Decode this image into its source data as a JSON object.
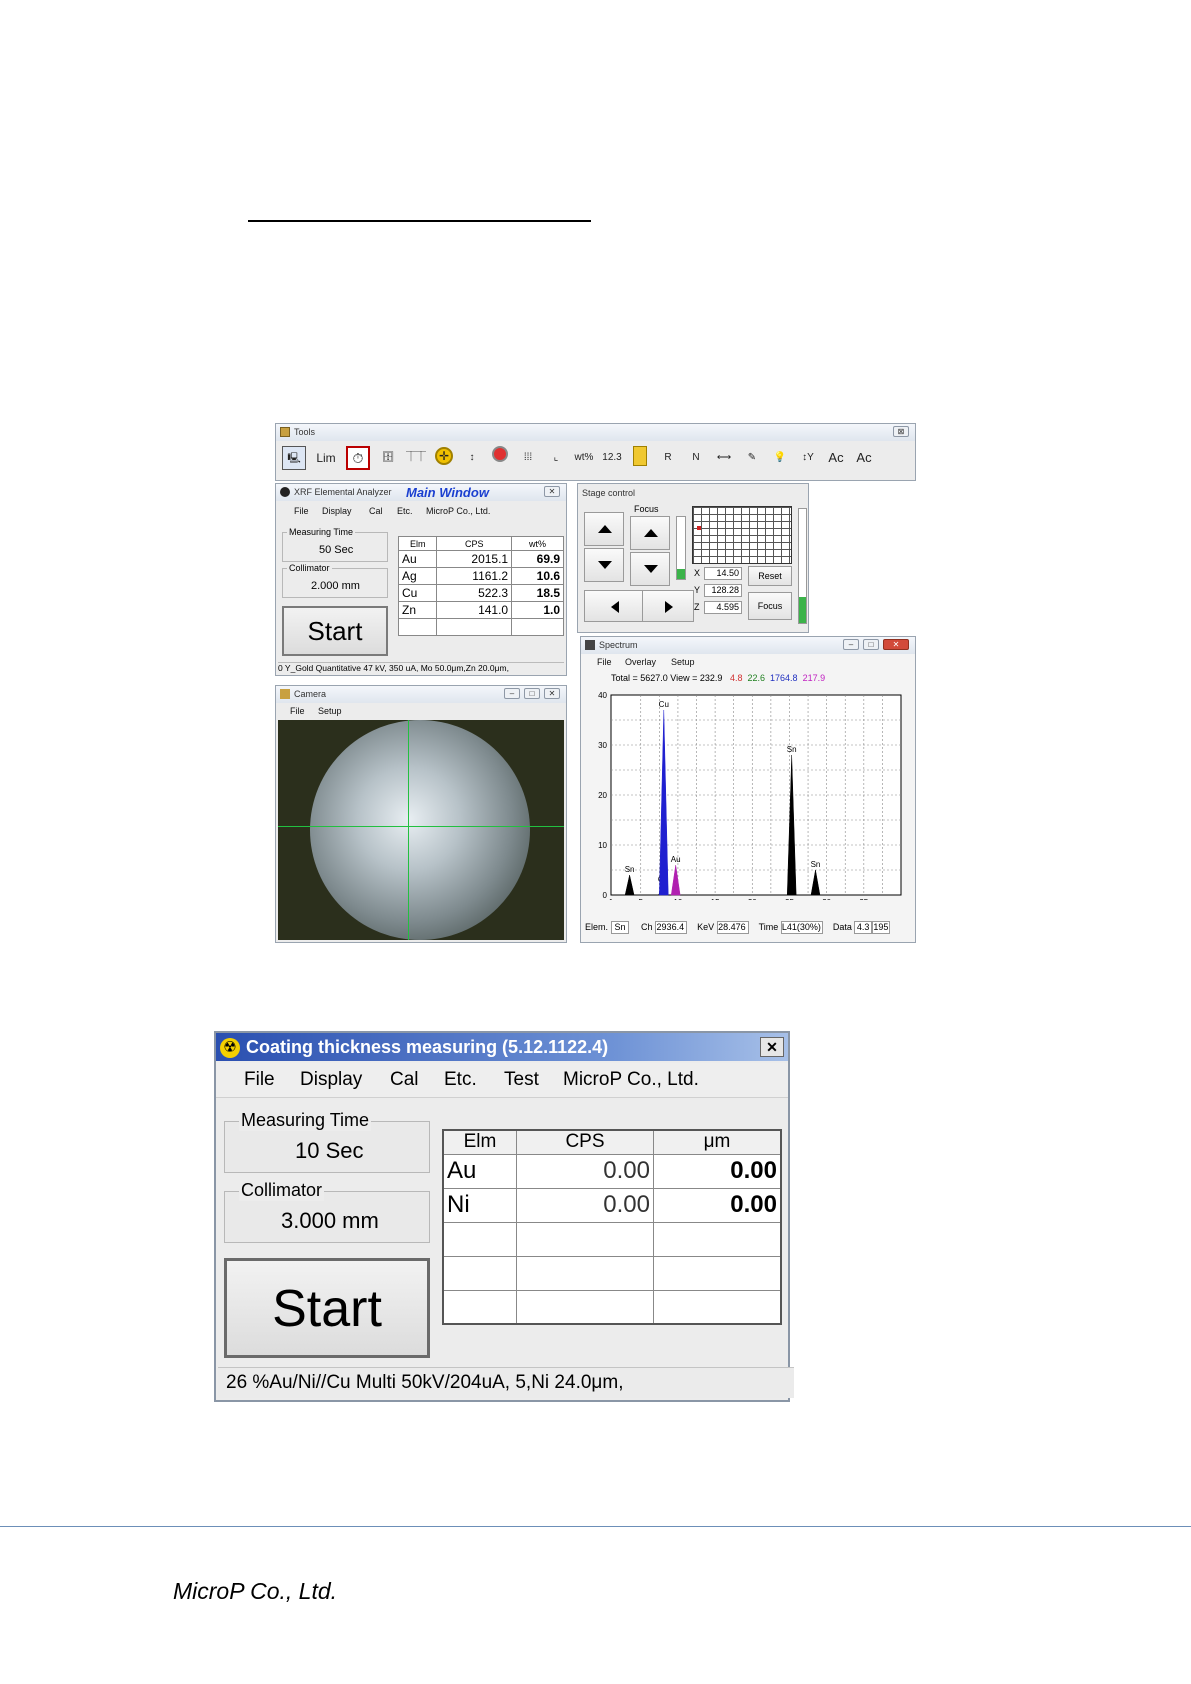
{
  "footer": {
    "company": "MicroP Co., Ltd."
  },
  "tools": {
    "title": "Tools",
    "close": "⊠",
    "lim_label": "Lim",
    "wt_label": "wt%",
    "num_label": "12.3",
    "r_label": "R",
    "n_label": "N",
    "ac_label": "Ac",
    "ac2_label": "Ac"
  },
  "xrf": {
    "title": "XRF Elemental Analyzer",
    "main_window": "Main Window",
    "menu": [
      "File",
      "Display",
      "Cal",
      "Etc.",
      "MicroP Co., Ltd."
    ],
    "measuring_time_label": "Measuring Time",
    "measuring_time_value": "50 Sec",
    "collimator_label": "Collimator",
    "collimator_value": "2.000 mm",
    "start_label": "Start",
    "headers": [
      "Elm",
      "CPS",
      "wt%"
    ],
    "rows": [
      {
        "elm": "Au",
        "cps": "2015.1",
        "val": "69.9"
      },
      {
        "elm": "Ag",
        "cps": "1161.2",
        "val": "10.6"
      },
      {
        "elm": "Cu",
        "cps": "522.3",
        "val": "18.5"
      },
      {
        "elm": "Zn",
        "cps": "141.0",
        "val": "1.0"
      }
    ],
    "status": "0 Y_Gold Quantitative 47 kV, 350 uA, Mo 50.0μm,Zn 20.0μm,"
  },
  "stage": {
    "title": "Stage control",
    "focus_label": "Focus",
    "x_label": "X",
    "x_value": "14.50",
    "y_label": "Y",
    "y_value": "128.28",
    "z_label": "Z",
    "z_value": "4.595",
    "reset_label": "Reset",
    "focus_button": "Focus"
  },
  "camera": {
    "title": "Camera",
    "menu": [
      "File",
      "Setup"
    ]
  },
  "spectrum": {
    "title": "Spectrum",
    "menu": [
      "File",
      "Overlay",
      "Setup"
    ],
    "total_text": "Total = 5627.0  View = 232.9",
    "v1": "4.8",
    "v2": "22.6",
    "v3": "1764.8",
    "v4": "217.9",
    "colors": {
      "v1": "#d03030",
      "v2": "#208020",
      "v3": "#2030c0",
      "v4": "#c020c0"
    },
    "status": {
      "elem_label": "Elem.",
      "elem_value": "Sn",
      "ch_label": "Ch",
      "ch_value": "2936.4",
      "kev_label": "KeV",
      "kev_value": "28.476",
      "time_label": "Time",
      "time_value": "L41(30%)",
      "data_label": "Data",
      "data_value": "4.3",
      "data_value2": "195"
    }
  },
  "chart_data": {
    "type": "line",
    "xlim": [
      1,
      40
    ],
    "ylim": [
      0,
      40
    ],
    "x_ticks": [
      "1",
      "5",
      "10",
      "15",
      "20",
      "25",
      "30",
      "35"
    ],
    "y_ticks": [
      "0",
      "10",
      "20",
      "30",
      "40"
    ],
    "grid": true,
    "peaks": [
      {
        "label": "Cu",
        "x": 8.0,
        "height": 2,
        "color": "#000000"
      },
      {
        "label": "Sn",
        "x": 3.5,
        "height": 4,
        "color": "#000000"
      },
      {
        "label": "Cu",
        "x": 8.1,
        "height": 37,
        "color": "#2020d0"
      },
      {
        "label": "Au",
        "x": 9.7,
        "height": 6,
        "color": "#b020b0"
      },
      {
        "label": "Sn",
        "x": 25.3,
        "height": 28,
        "color": "#000000"
      },
      {
        "label": "Sn",
        "x": 28.5,
        "height": 5,
        "color": "#000000"
      }
    ]
  },
  "coating": {
    "title": "Coating thickness measuring (5.12.1122.4)",
    "close": "✕",
    "menu": [
      "File",
      "Display",
      "Cal",
      "Etc.",
      "Test",
      "MicroP Co., Ltd."
    ],
    "measuring_time_label": "Measuring Time",
    "measuring_time_value": "10 Sec",
    "collimator_label": "Collimator",
    "collimator_value": "3.000 mm",
    "start_label": "Start",
    "headers": [
      "Elm",
      "CPS",
      "μm"
    ],
    "rows": [
      {
        "elm": "Au",
        "cps": "0.00",
        "val": "0.00"
      },
      {
        "elm": "Ni",
        "cps": "0.00",
        "val": "0.00"
      },
      {
        "elm": "",
        "cps": "",
        "val": ""
      },
      {
        "elm": "",
        "cps": "",
        "val": ""
      },
      {
        "elm": "",
        "cps": "",
        "val": ""
      }
    ],
    "status": "26 %Au/Ni//Cu Multi 50kV/204uA, 5,Ni 24.0μm,"
  }
}
